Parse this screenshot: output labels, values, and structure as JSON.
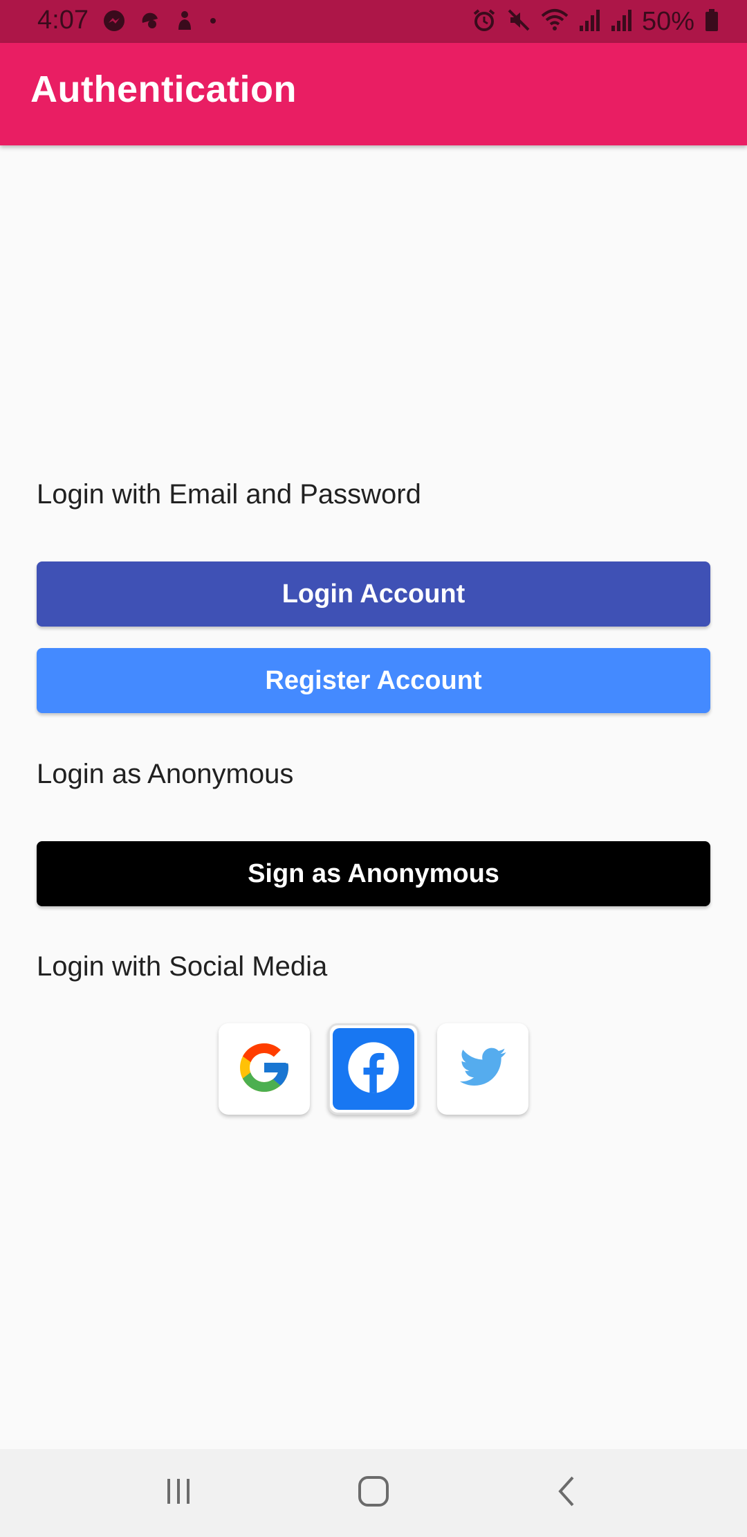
{
  "status_bar": {
    "time": "4:07",
    "battery": "50%",
    "left_icons": [
      "messenger-icon",
      "app-icon",
      "notification-icon",
      "dot-icon"
    ],
    "right_icons": [
      "alarm-icon",
      "mute-icon",
      "wifi-icon",
      "signal-icon",
      "signal-icon",
      "battery-icon"
    ]
  },
  "app_bar": {
    "title": "Authentication"
  },
  "email_section": {
    "label": "Login with Email and Password",
    "login_button": "Login Account",
    "register_button": "Register Account"
  },
  "anonymous_section": {
    "label": "Login as Anonymous",
    "anon_button": "Sign as Anonymous"
  },
  "social_section": {
    "label": "Login with Social Media",
    "providers": [
      "google-icon",
      "facebook-icon",
      "twitter-icon"
    ]
  },
  "nav_bar": {
    "buttons": [
      "recents-icon",
      "home-icon",
      "back-icon"
    ]
  },
  "colors": {
    "status_bar": "#ad1648",
    "app_bar": "#e91e63",
    "login_button": "#3f51b5",
    "register_button": "#448aff",
    "anon_button": "#000000",
    "facebook": "#1877f2",
    "twitter": "#55acee"
  }
}
